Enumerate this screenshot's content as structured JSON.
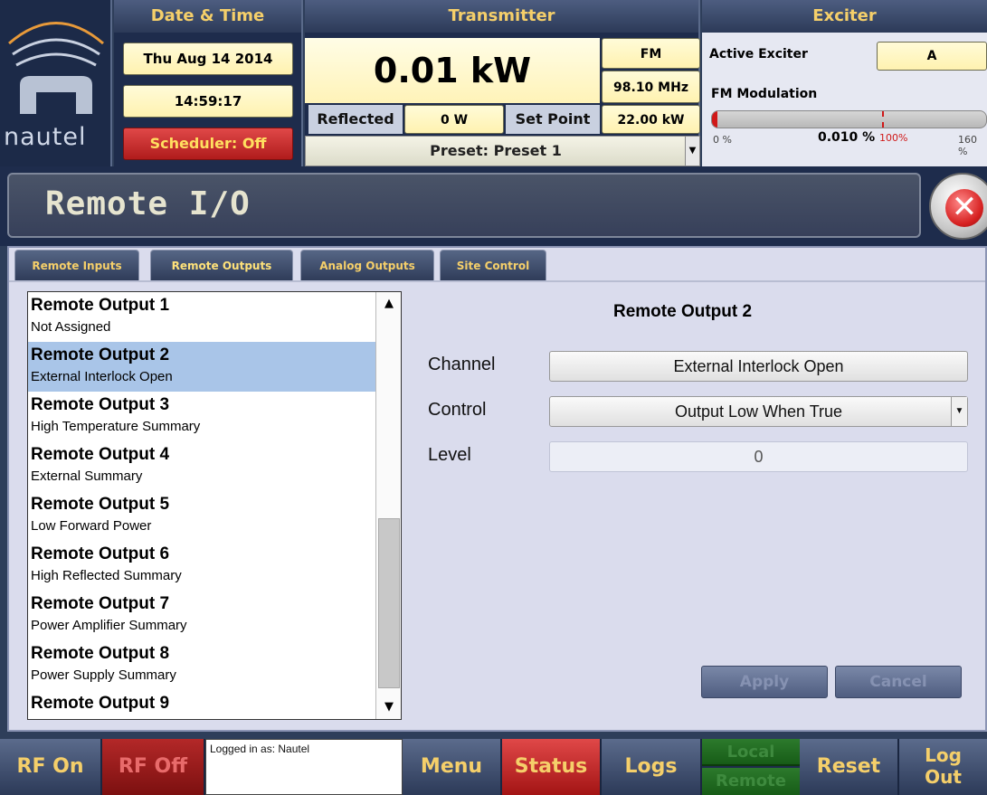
{
  "header": {
    "brand": "nautel",
    "datetime": {
      "title": "Date & Time",
      "date": "Thu Aug 14 2014",
      "time": "14:59:17",
      "scheduler": "Scheduler: Off"
    },
    "transmitter": {
      "title": "Transmitter",
      "power": "0.01 kW",
      "mode": "FM",
      "frequency": "98.10 MHz",
      "reflected_label": "Reflected",
      "reflected_value": "0 W",
      "setpoint_label": "Set Point",
      "setpoint_value": "22.00 kW",
      "preset": "Preset: Preset 1"
    },
    "exciter": {
      "title": "Exciter",
      "active_label": "Active Exciter",
      "active_value": "A",
      "modulation_label": "FM Modulation",
      "modulation_level_fraction": 6.25e-05,
      "scale_min": "0 %",
      "value": "0.010 %",
      "marker": "100%",
      "scale_max": "160 %"
    }
  },
  "page": {
    "title": "Remote I/O"
  },
  "tabs": [
    {
      "label": "Remote Inputs"
    },
    {
      "label": "Remote Outputs"
    },
    {
      "label": "Analog Outputs"
    },
    {
      "label": "Site Control"
    }
  ],
  "outputs": [
    {
      "title": "Remote Output 1",
      "sub": "Not Assigned"
    },
    {
      "title": "Remote Output 2",
      "sub": "External Interlock Open"
    },
    {
      "title": "Remote Output 3",
      "sub": "High Temperature Summary"
    },
    {
      "title": "Remote Output 4",
      "sub": "External Summary"
    },
    {
      "title": "Remote Output 5",
      "sub": "Low Forward Power"
    },
    {
      "title": "Remote Output 6",
      "sub": "High Reflected Summary"
    },
    {
      "title": "Remote Output 7",
      "sub": "Power Amplifier Summary"
    },
    {
      "title": "Remote Output 8",
      "sub": "Power Supply Summary"
    },
    {
      "title": "Remote Output 9",
      "sub": ""
    }
  ],
  "detail": {
    "title": "Remote Output 2",
    "channel_label": "Channel",
    "channel_value": "External Interlock Open",
    "control_label": "Control",
    "control_value": "Output Low When True",
    "level_label": "Level",
    "level_value": "0",
    "apply": "Apply",
    "cancel": "Cancel"
  },
  "footer": {
    "rf_on": "RF On",
    "rf_off": "RF Off",
    "login": "Logged in as: Nautel",
    "menu": "Menu",
    "status": "Status",
    "logs": "Logs",
    "local": "Local",
    "remote": "Remote",
    "reset": "Reset",
    "logout_line1": "Log",
    "logout_line2": "Out"
  }
}
